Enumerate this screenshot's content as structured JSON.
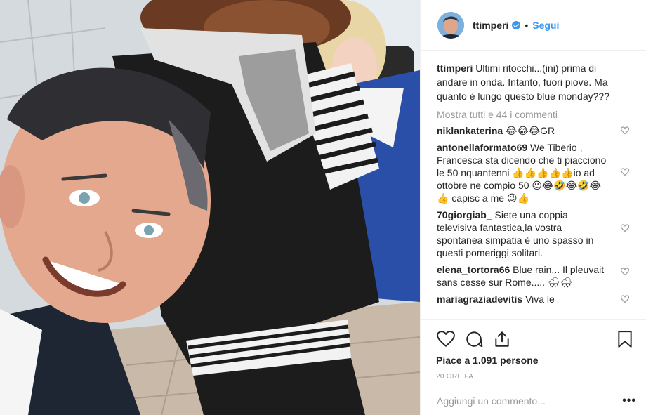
{
  "post": {
    "username": "ttimperi",
    "follow_label": "Segui",
    "separator": "•"
  },
  "caption": {
    "username": "ttimperi",
    "text": "Ultimi ritocchi...(ini) prima di andare in onda. Intanto, fuori piove. Ma quanto è lungo questo blue monday???"
  },
  "show_all": "Mostra tutti e 44 i commenti",
  "comments": [
    {
      "username": "niklankaterina",
      "text": "😂😂😂GR"
    },
    {
      "username": "antonellaformato69",
      "text": "We Tiberio , Francesca sta dicendo che ti piacciono le 50 nquantenni 👍👍👍👍👍io ad ottobre ne compio 50 😉😂🤣😂🤣😂👍 capisc a me 😉👍"
    },
    {
      "username": "70giorgiab_",
      "text": "Siete una coppia televisiva fantastica,la vostra spontanea simpatia è uno spasso in questi pomeriggi solitari."
    },
    {
      "username": "elena_tortora66",
      "text": "Blue rain... Il pleuvait sans cesse sur Rome..... 🌧🌧"
    },
    {
      "username": "mariagraziadevitis",
      "text": "Viva le"
    }
  ],
  "likes_text": "Piace a 1.091 persone",
  "time_text": "20 ORE FA",
  "add_comment_placeholder": "Aggiungi un commento...",
  "more_label": "•••",
  "icons": {
    "like": "heart-icon",
    "comment": "comment-icon",
    "share": "share-icon",
    "save": "bookmark-icon",
    "verified": "verified-badge-icon"
  },
  "colors": {
    "link": "#3897f0",
    "muted": "#999999",
    "text": "#262626",
    "border": "#efefef"
  }
}
